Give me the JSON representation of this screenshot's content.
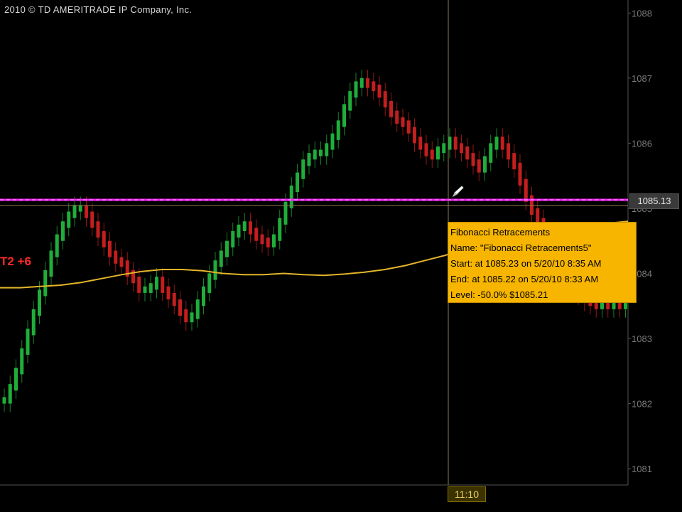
{
  "copyright": "2010 © TD AMERITRADE IP Company, Inc.",
  "study_label": "T2 +6",
  "price_badge": "1085.13",
  "time_badge": "11:10",
  "tooltip": {
    "title": "Fibonacci Retracements",
    "name_line": "Name: \"Fibonacci Retracements5\"",
    "start_line": "Start: at 1085.23 on 5/20/10 8:35 AM",
    "end_line": "End: at 1085.22 on 5/20/10 8:33 AM",
    "level_line": "Level: -50.0% $1085.21"
  },
  "colors": {
    "up": "#1fae3a",
    "down": "#c41e1e",
    "ma": "#e3b52a",
    "fib_line": "#ff22ff",
    "crosshair": "#8a7a52",
    "axis_text": "#7a7a7a"
  },
  "icons": {
    "cursor": "pencil-cursor-icon"
  },
  "chart_data": {
    "type": "line",
    "title": "",
    "xlabel": "",
    "ylabel": "",
    "ylim": [
      1080.75,
      1088.2
    ],
    "y_ticks": [
      1081,
      1082,
      1083,
      1084,
      1085,
      1086,
      1087,
      1088
    ],
    "x_marker": "11:10",
    "horizontal_line": 1085.13,
    "series": [
      {
        "values": [
          1082.05,
          1082.25,
          1082.5,
          1082.8,
          1083.1,
          1083.4,
          1083.7,
          1084.0,
          1084.3,
          1084.55,
          1084.75,
          1084.9,
          1085.0,
          1085.0,
          1084.9,
          1084.75,
          1084.6,
          1084.45,
          1084.3,
          1084.2,
          1084.15,
          1084.0,
          1083.9,
          1083.75,
          1083.75,
          1083.8,
          1083.9,
          1083.75,
          1083.65,
          1083.55,
          1083.4,
          1083.3,
          1083.35,
          1083.55,
          1083.75,
          1083.95,
          1084.15,
          1084.3,
          1084.45,
          1084.6,
          1084.7,
          1084.75,
          1084.65,
          1084.55,
          1084.5,
          1084.45,
          1084.55,
          1084.8,
          1085.05,
          1085.3,
          1085.5,
          1085.7,
          1085.8,
          1085.85,
          1085.85,
          1085.95,
          1086.1,
          1086.3,
          1086.55,
          1086.75,
          1086.9,
          1086.95,
          1086.9,
          1086.85,
          1086.75,
          1086.6,
          1086.45,
          1086.35,
          1086.3,
          1086.2,
          1086.05,
          1085.95,
          1085.85,
          1085.8,
          1085.9,
          1085.95,
          1086.05,
          1085.95,
          1085.9,
          1085.8,
          1085.7,
          1085.6,
          1085.75,
          1085.95,
          1086.05,
          1085.95,
          1085.8,
          1085.65,
          1085.4,
          1085.15,
          1084.95,
          1084.8,
          1084.6,
          1084.45,
          1084.3,
          1084.15,
          1084.0,
          1083.85,
          1083.7,
          1083.6,
          1083.55,
          1083.5,
          1083.55,
          1083.5,
          1083.55,
          1083.5,
          1083.6
        ]
      },
      {
        "values": [
          1083.78,
          1083.78,
          1083.8,
          1083.82,
          1083.86,
          1083.92,
          1083.98,
          1084.03,
          1084.06,
          1084.06,
          1084.04,
          1084.0,
          1083.98,
          1083.98,
          1084.0,
          1083.98,
          1083.97,
          1083.99,
          1084.02,
          1084.06,
          1084.12,
          1084.2,
          1084.28,
          1084.4,
          1084.52,
          1084.62,
          1084.68,
          1084.72,
          1084.74,
          1084.75,
          1084.77,
          1084.8
        ]
      }
    ]
  }
}
